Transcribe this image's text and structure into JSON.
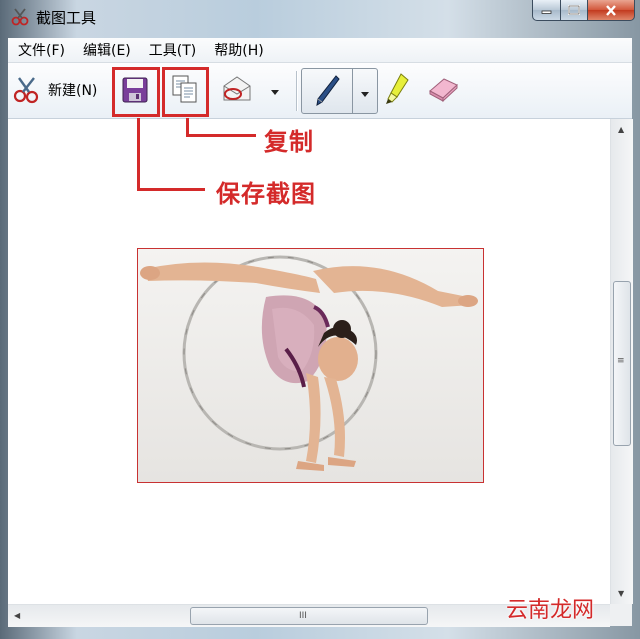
{
  "window": {
    "title": "截图工具",
    "icon": "scissors-app-icon"
  },
  "menu": {
    "items": [
      {
        "label": "文件(F)"
      },
      {
        "label": "编辑(E)"
      },
      {
        "label": "工具(T)"
      },
      {
        "label": "帮助(H)"
      }
    ]
  },
  "toolbar": {
    "new_label": "新建(N)",
    "save_icon": "floppy-disk-icon",
    "copy_icon": "copy-icon",
    "send_icon": "envelope-icon",
    "pen_icon": "pen-icon",
    "highlighter_icon": "highlighter-icon",
    "eraser_icon": "eraser-icon"
  },
  "annotations": {
    "copy_label": "复制",
    "save_label": "保存截图",
    "color": "#d42a2a"
  },
  "canvas": {
    "content": "gymnast-with-hoop-photo"
  },
  "scrollbars": {
    "v_grip": "≡",
    "h_grip": "III"
  },
  "watermark": "云南龙网"
}
